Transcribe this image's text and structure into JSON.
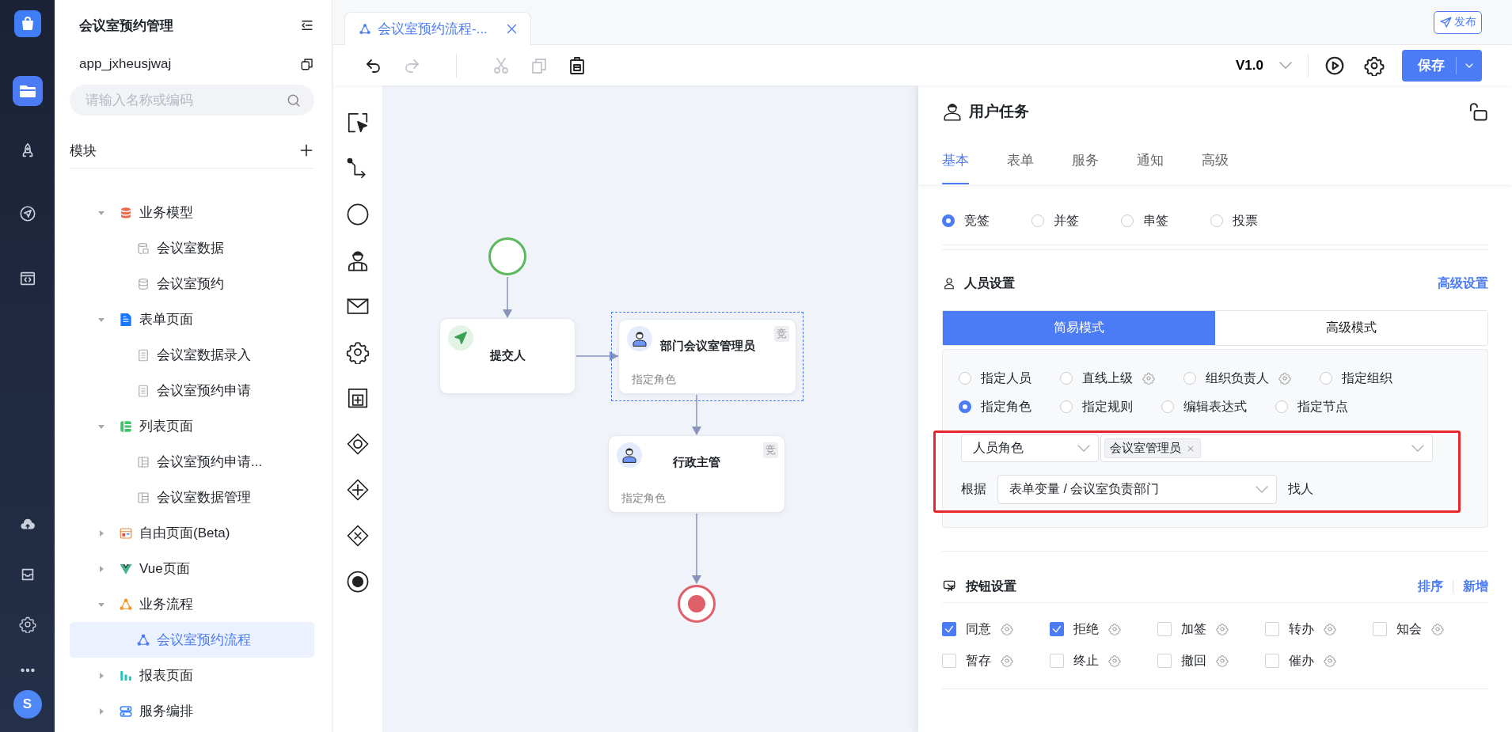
{
  "rail": {
    "avatar": "S"
  },
  "sidebar": {
    "title": "会议室预约管理",
    "app_code": "app_jxheusjwaj",
    "search": {
      "placeholder": "请输入名称或编码"
    },
    "section": "模块",
    "tree": [
      {
        "label": "业务模型",
        "kind": "model",
        "expanded": true,
        "selected": false,
        "children": [
          {
            "label": "会议室数据",
            "kind": "data-table",
            "selected": false
          },
          {
            "label": "会议室预约",
            "kind": "database",
            "selected": false
          }
        ]
      },
      {
        "label": "表单页面",
        "kind": "form",
        "expanded": true,
        "selected": false,
        "children": [
          {
            "label": "会议室数据录入",
            "kind": "doc",
            "selected": false
          },
          {
            "label": "会议室预约申请",
            "kind": "doc",
            "selected": false
          }
        ]
      },
      {
        "label": "列表页面",
        "kind": "list",
        "expanded": true,
        "selected": false,
        "children": [
          {
            "label": "会议室预约申请...",
            "kind": "grid",
            "selected": false
          },
          {
            "label": "会议室数据管理",
            "kind": "grid",
            "selected": false
          }
        ]
      },
      {
        "label": "自由页面(Beta)",
        "kind": "free",
        "expanded": false,
        "selected": false
      },
      {
        "label": "Vue页面",
        "kind": "vue",
        "expanded": false,
        "selected": false
      },
      {
        "label": "业务流程",
        "kind": "flow",
        "expanded": true,
        "selected": false,
        "children": [
          {
            "label": "会议室预约流程",
            "kind": "flow-item",
            "selected": true
          }
        ]
      },
      {
        "label": "报表页面",
        "kind": "report",
        "expanded": false,
        "selected": false
      },
      {
        "label": "服务编排",
        "kind": "service",
        "expanded": false,
        "selected": false
      }
    ]
  },
  "editor": {
    "tab": {
      "label": "会议室预约流程-...",
      "selected": true
    },
    "publish": "发布",
    "tools": [
      {
        "kind": "undo",
        "disabled": false
      },
      {
        "kind": "redo",
        "disabled": true
      },
      {
        "kind": "cut",
        "disabled": true
      },
      {
        "kind": "copy",
        "disabled": true
      },
      {
        "kind": "paste",
        "disabled": false
      }
    ],
    "version": "V1.0",
    "save": "保存"
  },
  "flow": {
    "nodes": [
      {
        "kind": "start",
        "selected": false
      },
      {
        "kind": "initiator",
        "title": "提交人",
        "selected": false
      },
      {
        "kind": "user",
        "title": "部门会议室管理员",
        "badge": "竞",
        "note": "指定角色",
        "selected": true
      },
      {
        "kind": "user",
        "title": "行政主管",
        "badge": "竞",
        "note": "指定角色",
        "selected": false
      },
      {
        "kind": "end",
        "selected": false
      }
    ]
  },
  "panel": {
    "title": "用户任务",
    "tabs": [
      {
        "label": "基本",
        "selected": true
      },
      {
        "label": "表单",
        "selected": false
      },
      {
        "label": "服务",
        "selected": false
      },
      {
        "label": "通知",
        "selected": false
      },
      {
        "label": "高级",
        "selected": false
      }
    ],
    "task_mode": [
      {
        "label": "竞签",
        "selected": true
      },
      {
        "label": "并签",
        "selected": false
      },
      {
        "label": "串签",
        "selected": false
      },
      {
        "label": "投票",
        "selected": false
      }
    ],
    "personnel": {
      "heading": "人员设置",
      "link": "高级设置",
      "modes": [
        {
          "label": "简易模式",
          "selected": true
        },
        {
          "label": "高级模式",
          "selected": false
        }
      ],
      "options": [
        {
          "label": "指定人员",
          "selected": false,
          "settings": false
        },
        {
          "label": "直线上级",
          "selected": false,
          "settings": true
        },
        {
          "label": "组织负责人",
          "selected": false,
          "settings": true
        },
        {
          "label": "指定组织",
          "selected": false,
          "settings": false
        },
        {
          "label": "指定角色",
          "selected": true,
          "settings": false
        },
        {
          "label": "指定规则",
          "selected": false,
          "settings": false
        },
        {
          "label": "编辑表达式",
          "selected": false,
          "settings": false
        },
        {
          "label": "指定节点",
          "selected": false,
          "settings": false
        }
      ],
      "highlight": true,
      "role_type": "人员角色",
      "roles": [
        "会议室管理员"
      ],
      "basis_label": "根据",
      "basis": "表单变量 / 会议室负责部门",
      "basis_suffix": "找人"
    },
    "buttons": {
      "heading": "按钮设置",
      "links": [
        "排序",
        "新增"
      ],
      "items": [
        {
          "label": "同意",
          "checked": true
        },
        {
          "label": "拒绝",
          "checked": true
        },
        {
          "label": "加签",
          "checked": false
        },
        {
          "label": "转办",
          "checked": false
        },
        {
          "label": "知会",
          "checked": false
        },
        {
          "label": "暂存",
          "checked": false
        },
        {
          "label": "终止",
          "checked": false
        },
        {
          "label": "撤回",
          "checked": false
        },
        {
          "label": "催办",
          "checked": false
        }
      ]
    }
  }
}
